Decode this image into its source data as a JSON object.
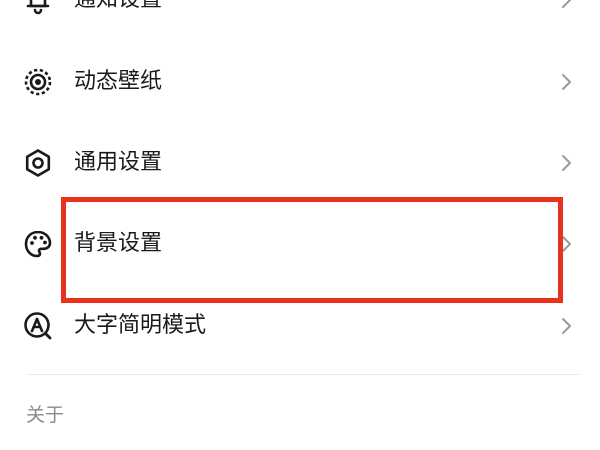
{
  "settings": {
    "items": [
      {
        "label": "通知设置",
        "icon": "bell-icon"
      },
      {
        "label": "动态壁纸",
        "icon": "dynamic-wallpaper-icon"
      },
      {
        "label": "通用设置",
        "icon": "gear-icon"
      },
      {
        "label": "背景设置",
        "icon": "palette-icon"
      },
      {
        "label": "大字简明模式",
        "icon": "large-text-icon"
      }
    ],
    "section_label": "关于"
  },
  "colors": {
    "text": "#1a1a1a",
    "secondary_text": "#8a8a8a",
    "chevron": "#9a9a9a",
    "highlight_border": "#e8321e",
    "divider": "#ececec"
  }
}
